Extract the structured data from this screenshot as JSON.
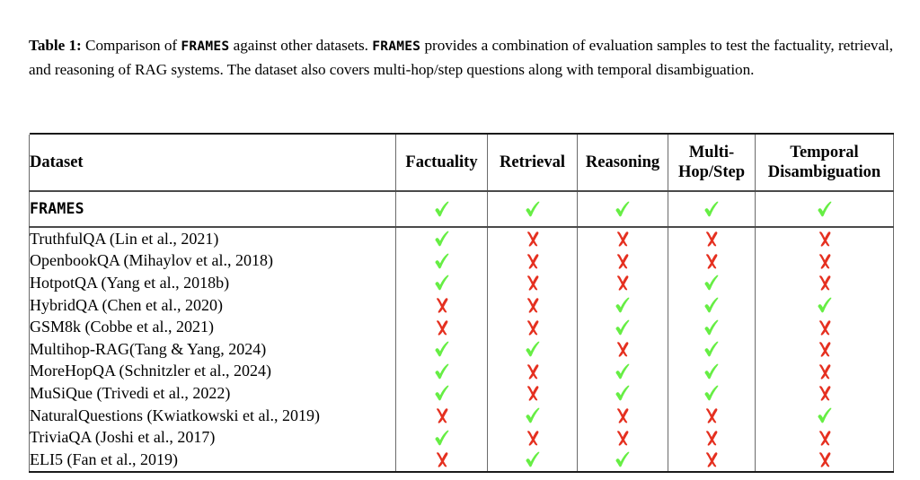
{
  "caption": {
    "label": "Table 1:",
    "text_part1": " Comparison of ",
    "mono1": "FRAMES",
    "text_part2": " against other datasets. ",
    "mono2": "FRAMES",
    "text_part3": " provides a combination of evaluation samples to test the factuality, retrieval, and reasoning of RAG systems. The dataset also covers multi-hop/step questions along with temporal disambiguation."
  },
  "table": {
    "columns": [
      {
        "id": "dataset",
        "label": "Dataset"
      },
      {
        "id": "factuality",
        "label": "Factuality"
      },
      {
        "id": "retrieval",
        "label": "Retrieval"
      },
      {
        "id": "reasoning",
        "label": "Reasoning"
      },
      {
        "id": "multihop",
        "label_line1": "Multi-",
        "label_line2": "Hop/Step"
      },
      {
        "id": "temporal",
        "label_line1": "Temporal",
        "label_line2": "Disambiguation"
      }
    ],
    "highlight_row": {
      "name": "FRAMES",
      "marks": [
        "check",
        "check",
        "check",
        "check",
        "check"
      ]
    },
    "rows": [
      {
        "name": "TruthfulQA (Lin et al., 2021)",
        "marks": [
          "check",
          "cross",
          "cross",
          "cross",
          "cross"
        ]
      },
      {
        "name": "OpenbookQA (Mihaylov et al., 2018)",
        "marks": [
          "check",
          "cross",
          "cross",
          "cross",
          "cross"
        ]
      },
      {
        "name": "HotpotQA (Yang et al., 2018b)",
        "marks": [
          "check",
          "cross",
          "cross",
          "check",
          "cross"
        ]
      },
      {
        "name": "HybridQA (Chen et al., 2020)",
        "marks": [
          "cross",
          "cross",
          "check",
          "check",
          "check"
        ]
      },
      {
        "name": "GSM8k (Cobbe et al., 2021)",
        "marks": [
          "cross",
          "cross",
          "check",
          "check",
          "cross"
        ]
      },
      {
        "name": "Multihop-RAG(Tang & Yang, 2024)",
        "marks": [
          "check",
          "check",
          "cross",
          "check",
          "cross"
        ]
      },
      {
        "name": "MoreHopQA (Schnitzler et al., 2024)",
        "marks": [
          "check",
          "cross",
          "check",
          "check",
          "cross"
        ]
      },
      {
        "name": "MuSiQue (Trivedi et al., 2022)",
        "marks": [
          "check",
          "cross",
          "check",
          "check",
          "cross"
        ]
      },
      {
        "name": "NaturalQuestions (Kwiatkowski et al., 2019)",
        "marks": [
          "cross",
          "check",
          "cross",
          "cross",
          "check"
        ]
      },
      {
        "name": "TriviaQA (Joshi et al., 2017)",
        "marks": [
          "check",
          "cross",
          "cross",
          "cross",
          "cross"
        ]
      },
      {
        "name": "ELI5 (Fan et al., 2019)",
        "marks": [
          "cross",
          "check",
          "check",
          "cross",
          "cross"
        ]
      }
    ]
  },
  "colors": {
    "check": "#66ee44",
    "cross": "#e53020",
    "rule": "#1a1a1a",
    "vertical_rule": "#6b6b6b"
  }
}
